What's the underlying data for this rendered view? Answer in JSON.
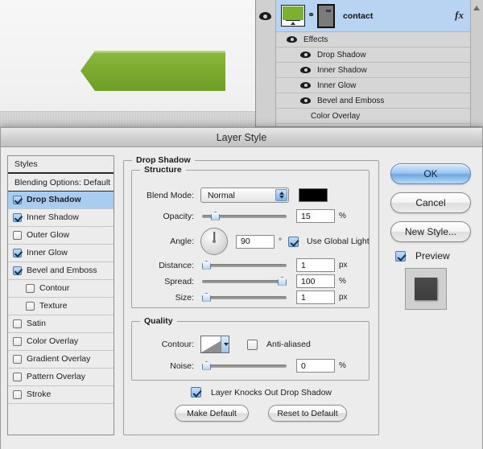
{
  "canvas": {
    "shape_name": "green-arrow-banner",
    "shape_color": "#7bab2f"
  },
  "layers_panel": {
    "layer": {
      "name": "contact",
      "fx_badge": "fx",
      "eye_icon": "eye-icon",
      "link_icon": "link-icon"
    },
    "effects_header": "Effects",
    "effects": [
      "Drop Shadow",
      "Inner Shadow",
      "Inner Glow",
      "Bevel and Emboss",
      "Color Overlay"
    ]
  },
  "dialog": {
    "title": "Layer Style",
    "styles_panel": {
      "header": "Styles",
      "blending_options": "Blending Options: Default",
      "items": [
        {
          "label": "Drop Shadow",
          "checked": true,
          "selected": true,
          "sub": false
        },
        {
          "label": "Inner Shadow",
          "checked": true,
          "selected": false,
          "sub": false
        },
        {
          "label": "Outer Glow",
          "checked": false,
          "selected": false,
          "sub": false
        },
        {
          "label": "Inner Glow",
          "checked": true,
          "selected": false,
          "sub": false
        },
        {
          "label": "Bevel and Emboss",
          "checked": true,
          "selected": false,
          "sub": false
        },
        {
          "label": "Contour",
          "checked": false,
          "selected": false,
          "sub": true
        },
        {
          "label": "Texture",
          "checked": false,
          "selected": false,
          "sub": true
        },
        {
          "label": "Satin",
          "checked": false,
          "selected": false,
          "sub": false
        },
        {
          "label": "Color Overlay",
          "checked": false,
          "selected": false,
          "sub": false
        },
        {
          "label": "Gradient Overlay",
          "checked": false,
          "selected": false,
          "sub": false
        },
        {
          "label": "Pattern Overlay",
          "checked": false,
          "selected": false,
          "sub": false
        },
        {
          "label": "Stroke",
          "checked": false,
          "selected": false,
          "sub": false
        }
      ]
    },
    "drop_shadow": {
      "group_title": "Drop Shadow",
      "structure": {
        "group_title": "Structure",
        "blend_mode_label": "Blend Mode:",
        "blend_mode_value": "Normal",
        "shadow_color": "#000000",
        "opacity_label": "Opacity:",
        "opacity_value": "15",
        "opacity_unit": "%",
        "angle_label": "Angle:",
        "angle_value": "90",
        "angle_unit": "°",
        "use_global_light_label": "Use Global Light",
        "use_global_light_checked": true,
        "distance_label": "Distance:",
        "distance_value": "1",
        "distance_unit": "px",
        "spread_label": "Spread:",
        "spread_value": "100",
        "spread_unit": "%",
        "size_label": "Size:",
        "size_value": "1",
        "size_unit": "px"
      },
      "quality": {
        "group_title": "Quality",
        "contour_label": "Contour:",
        "anti_aliased_label": "Anti-aliased",
        "anti_aliased_checked": false,
        "noise_label": "Noise:",
        "noise_value": "0",
        "noise_unit": "%"
      },
      "knockout_label": "Layer Knocks Out Drop Shadow",
      "knockout_checked": true,
      "make_default_label": "Make Default",
      "reset_default_label": "Reset to Default"
    },
    "buttons": {
      "ok": "OK",
      "cancel": "Cancel",
      "new_style": "New Style...",
      "preview_label": "Preview",
      "preview_checked": true
    }
  }
}
